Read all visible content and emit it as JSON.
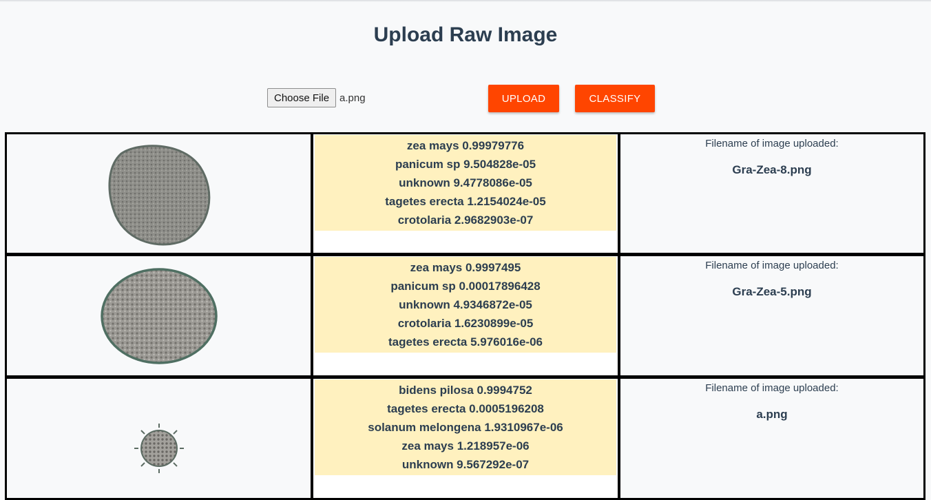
{
  "page": {
    "title": "Upload Raw Image"
  },
  "file_input": {
    "button_label": "Choose File",
    "selected_file": "a.png"
  },
  "actions": {
    "upload_label": "UPLOAD",
    "classify_label": "CLASSIFY",
    "accent_color": "#ff4500"
  },
  "results": [
    {
      "image": "pollen grain, large oval",
      "predictions": [
        "zea mays 0.99979776",
        "panicum sp 9.504828e-05",
        "unknown 9.4778086e-05",
        "tagetes erecta 1.2154024e-05",
        "crotolaria 2.9682903e-07"
      ],
      "meta_label": "Filename of image uploaded:",
      "filename": "Gra-Zea-8.png"
    },
    {
      "image": "pollen grain, large oval",
      "predictions": [
        "zea mays 0.9997495",
        "panicum sp 0.00017896428",
        "unknown 4.9346872e-05",
        "crotolaria 1.6230899e-05",
        "tagetes erecta 5.976016e-06"
      ],
      "meta_label": "Filename of image uploaded:",
      "filename": "Gra-Zea-5.png"
    },
    {
      "image": "pollen grain, small spiky",
      "predictions": [
        "bidens pilosa 0.9994752",
        "tagetes erecta 0.0005196208",
        "solanum melongena 1.9310967e-06",
        "zea mays 1.218957e-06",
        "unknown 9.567292e-07"
      ],
      "meta_label": "Filename of image uploaded:",
      "filename": "a.png"
    }
  ]
}
